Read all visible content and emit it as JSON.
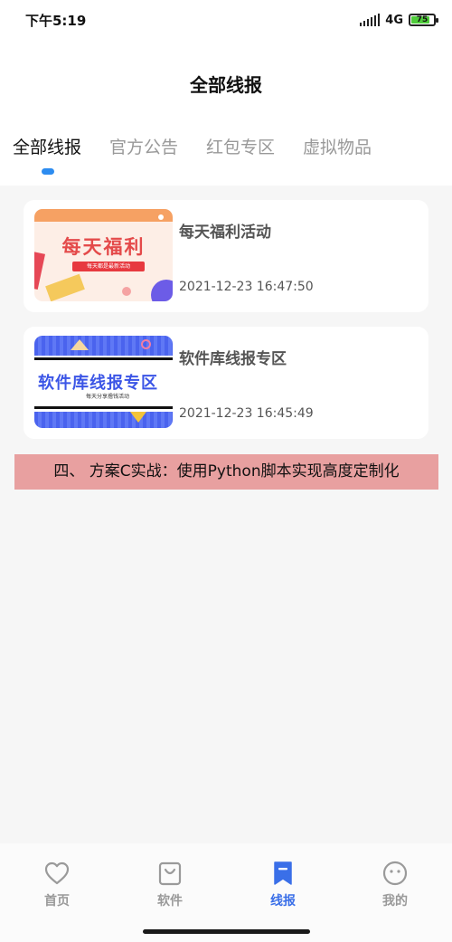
{
  "status_bar": {
    "time": "下午5:19",
    "network": "4G",
    "battery": "75",
    "battery_level": 0.75
  },
  "header": {
    "title": "全部线报"
  },
  "tabs": [
    {
      "label": "全部线报",
      "active": true
    },
    {
      "label": "官方公告",
      "active": false
    },
    {
      "label": "红包专区",
      "active": false
    },
    {
      "label": "虚拟物品",
      "active": false
    }
  ],
  "cards": [
    {
      "title": "每天福利活动",
      "date": "2021-12-23 16:47:50",
      "thumb_big": "每天福利",
      "thumb_small": "每天都是最新活动"
    },
    {
      "title": "软件库线报专区",
      "date": "2021-12-23 16:45:49",
      "thumb_big": "软件库线报专区",
      "thumb_small": "每天分享撸钱活动"
    }
  ],
  "banner": {
    "text": "四、 方案C实战：使用Python脚本实现高度定制化"
  },
  "bottom_nav": [
    {
      "label": "首页",
      "icon": "heart-icon",
      "active": false
    },
    {
      "label": "软件",
      "icon": "bag-icon",
      "active": false
    },
    {
      "label": "线报",
      "icon": "bookmark-icon",
      "active": true
    },
    {
      "label": "我的",
      "icon": "face-icon",
      "active": false
    }
  ],
  "colors": {
    "accent": "#3a6fe8",
    "tab_indicator": "#2d8cf0",
    "banner_bg": "#e8a0a0",
    "inactive": "#999999"
  }
}
